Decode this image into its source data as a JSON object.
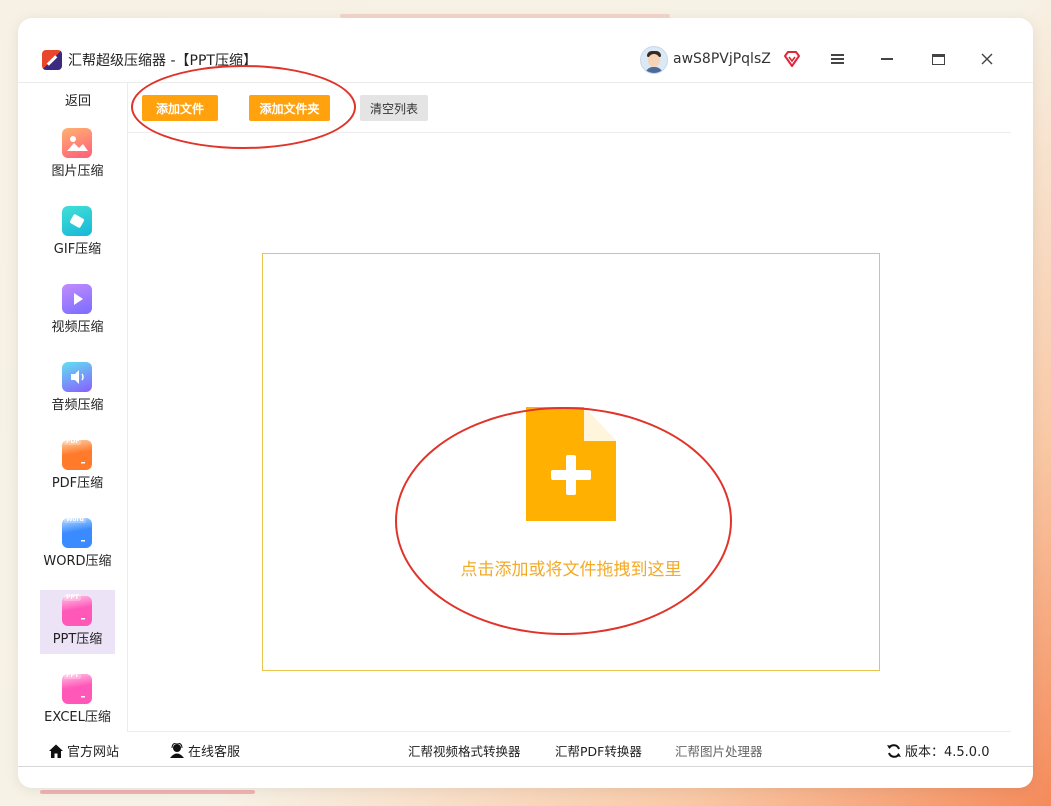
{
  "app": {
    "title": "汇帮超级压缩器  -【PPT压缩】",
    "username": "awS8PVjPqlsZ"
  },
  "window_controls": {
    "menu_icon": "hamburger-icon",
    "minimize_icon": "minimize-icon",
    "maximize_icon": "maximize-icon",
    "close_icon": "close-icon"
  },
  "sidebar": {
    "back_label": "返回",
    "items": [
      {
        "label": "图片压缩",
        "icon": "image-icon"
      },
      {
        "label": "GIF压缩",
        "icon": "gif-icon"
      },
      {
        "label": "视频压缩",
        "icon": "video-play-icon"
      },
      {
        "label": "音频压缩",
        "icon": "audio-speaker-icon"
      },
      {
        "label": "PDF压缩",
        "icon": "pdf-folder-icon",
        "tag": "PDF"
      },
      {
        "label": "WORD压缩",
        "icon": "word-folder-icon",
        "tag": "Word"
      },
      {
        "label": "PPT压缩",
        "icon": "ppt-folder-icon",
        "tag": "PPT",
        "active": true
      },
      {
        "label": "EXCEL压缩",
        "icon": "excel-folder-icon",
        "tag": "PPT"
      }
    ]
  },
  "toolbar": {
    "add_file": "添加文件",
    "add_folder": "添加文件夹",
    "clear_list": "清空列表"
  },
  "dropzone": {
    "text": "点击添加或将文件拖拽到这里",
    "icon": "add-file-icon"
  },
  "footer": {
    "official_site": "官方网站",
    "online_service": "在线客服",
    "video_converter": "汇帮视频格式转换器",
    "pdf_converter": "汇帮PDF转换器",
    "image_processor": "汇帮图片处理器",
    "version_label": "版本：4.5.0.0"
  },
  "colors": {
    "accent_orange": "#ffa20e",
    "drop_text": "#f3aa25",
    "annotation_red": "#e0342a",
    "active_bg": "#ece3f7"
  }
}
